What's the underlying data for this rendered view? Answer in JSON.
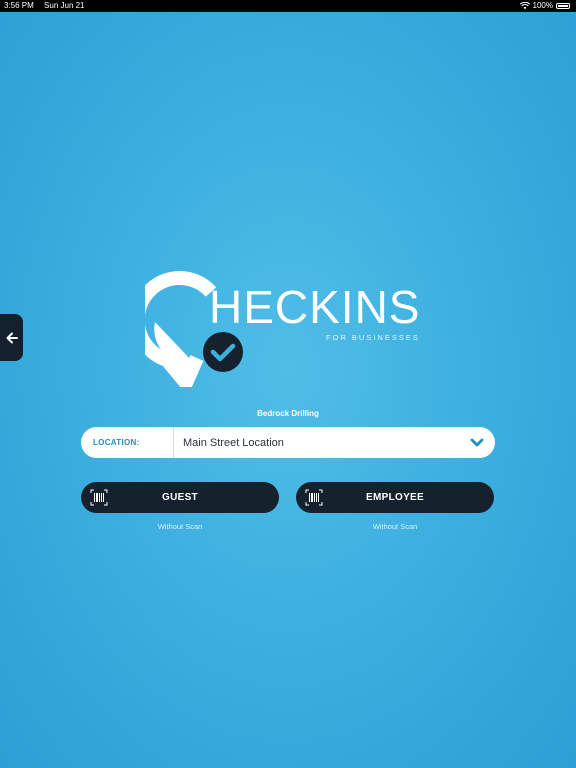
{
  "status_bar": {
    "time": "3:56 PM",
    "date": "Sun Jun 21",
    "battery": "100%",
    "wifi_icon": "wifi-icon",
    "battery_icon": "battery-icon"
  },
  "nav": {
    "back_icon": "arrow-left-icon"
  },
  "logo": {
    "text": "HECKINS",
    "subtitle": "FOR BUSINESSES"
  },
  "company": {
    "name": "Bedrock Drilling"
  },
  "location": {
    "label": "LOCATION:",
    "value": "Main Street Location",
    "icon": "chevron-down-icon"
  },
  "actions": {
    "guest": {
      "label": "GUEST",
      "caption": "Without Scan",
      "icon": "barcode-scan-icon"
    },
    "employee": {
      "label": "EMPLOYEE",
      "caption": "Without Scan",
      "icon": "barcode-scan-icon"
    }
  },
  "colors": {
    "background": "#3db0e0",
    "button": "#16212e",
    "accent": "#1b8fbf"
  }
}
